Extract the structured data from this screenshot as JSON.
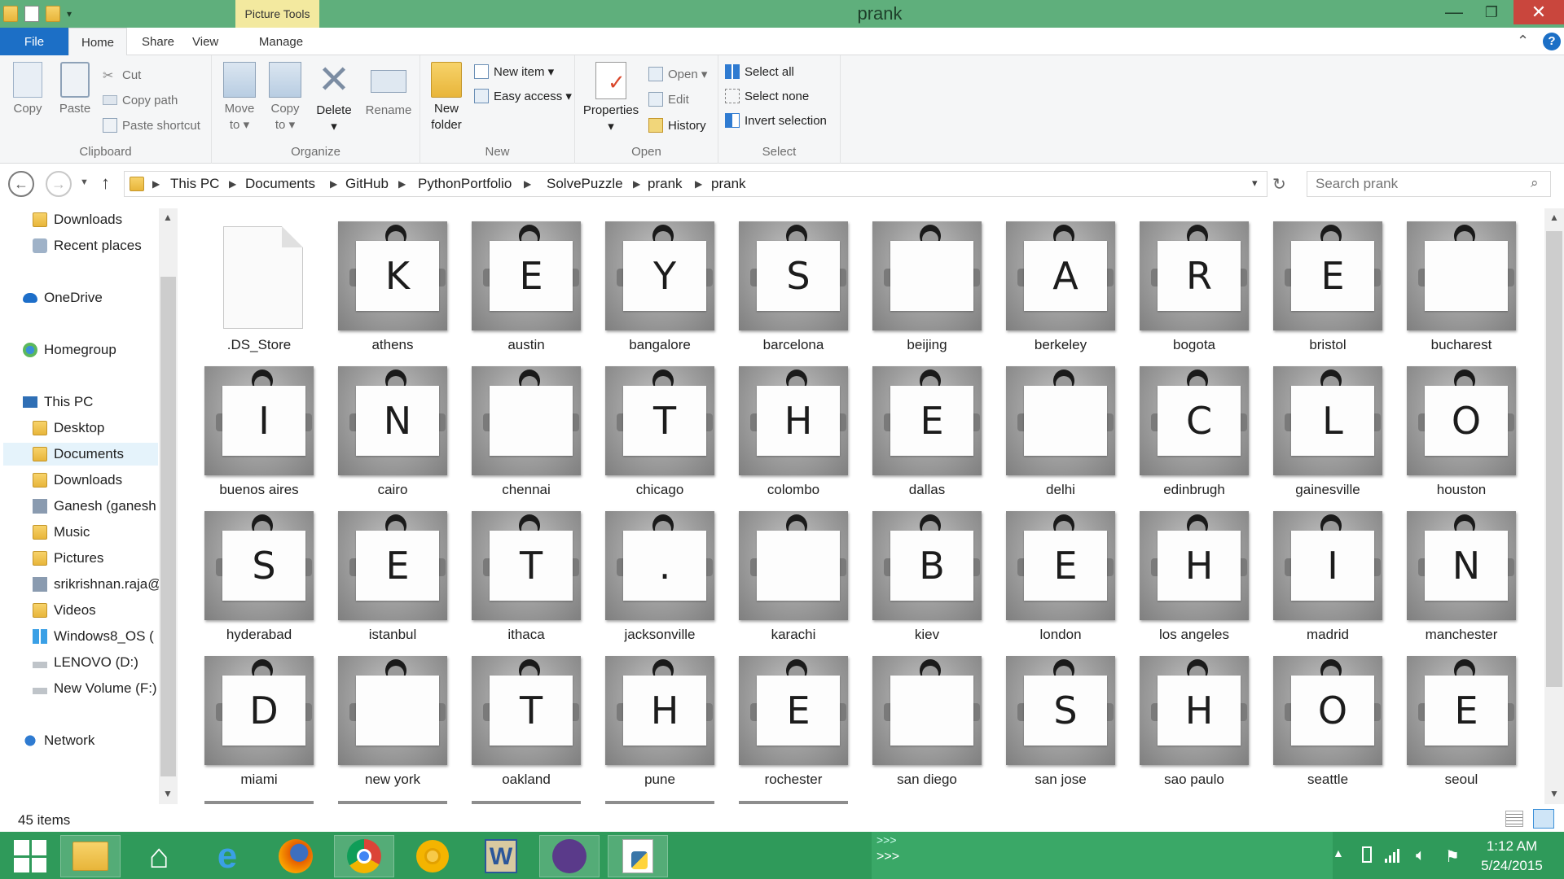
{
  "window": {
    "title": "prank",
    "context_tab": "Picture Tools",
    "minimize_glyph": "—",
    "restore_glyph": "❐",
    "close_glyph": "✕"
  },
  "ribbon_tabs": {
    "file": "File",
    "home": "Home",
    "share": "Share",
    "view": "View",
    "manage": "Manage"
  },
  "ribbon": {
    "clipboard": {
      "label": "Clipboard",
      "copy": "Copy",
      "paste": "Paste",
      "cut": "Cut",
      "copy_path": "Copy path",
      "paste_shortcut": "Paste shortcut"
    },
    "organize": {
      "label": "Organize",
      "move_to": "Move",
      "move_to_2": "to ▾",
      "copy_to": "Copy",
      "copy_to_2": "to ▾",
      "delete": "Delete",
      "delete_2": "▾",
      "rename": "Rename"
    },
    "new": {
      "label": "New",
      "new_folder": "New",
      "new_folder_2": "folder",
      "new_item": "New item ▾",
      "easy_access": "Easy access ▾"
    },
    "open": {
      "label": "Open",
      "properties": "Properties",
      "properties_2": "▾",
      "open": "Open ▾",
      "edit": "Edit",
      "history": "History"
    },
    "select": {
      "label": "Select",
      "select_all": "Select all",
      "select_none": "Select none",
      "invert_selection": "Invert selection"
    }
  },
  "address": {
    "breadcrumbs": [
      "This PC",
      "Documents",
      "GitHub",
      "PythonPortfolio",
      "SolvePuzzle",
      "prank",
      "prank"
    ],
    "search_placeholder": "Search prank"
  },
  "nav_pane": {
    "items": [
      {
        "label": "Downloads",
        "icon": "folder-icon"
      },
      {
        "label": "Recent places",
        "icon": "recent-places-icon"
      },
      {
        "label": "OneDrive",
        "icon": "cloud-icon"
      },
      {
        "label": "Homegroup",
        "icon": "homegroup-icon"
      },
      {
        "label": "This PC",
        "icon": "computer-icon"
      },
      {
        "label": "Desktop",
        "icon": "folder-icon"
      },
      {
        "label": "Documents",
        "icon": "folder-icon"
      },
      {
        "label": "Downloads",
        "icon": "folder-icon"
      },
      {
        "label": "Ganesh (ganesh",
        "icon": "folder-icon"
      },
      {
        "label": "Music",
        "icon": "folder-icon"
      },
      {
        "label": "Pictures",
        "icon": "folder-icon"
      },
      {
        "label": "srikrishnan.raja@",
        "icon": "folder-icon"
      },
      {
        "label": "Videos",
        "icon": "folder-icon"
      },
      {
        "label": "Windows8_OS (",
        "icon": "drive-icon"
      },
      {
        "label": "LENOVO (D:)",
        "icon": "drive-icon"
      },
      {
        "label": "New Volume (F:)",
        "icon": "drive-icon"
      },
      {
        "label": "Network",
        "icon": "network-icon"
      }
    ]
  },
  "files": [
    {
      "name": ".DS_Store",
      "letter": "",
      "type": "document"
    },
    {
      "name": "athens",
      "letter": "K",
      "type": "image"
    },
    {
      "name": "austin",
      "letter": "E",
      "type": "image"
    },
    {
      "name": "bangalore",
      "letter": "Y",
      "type": "image"
    },
    {
      "name": "barcelona",
      "letter": "S",
      "type": "image"
    },
    {
      "name": "beijing",
      "letter": "",
      "type": "image"
    },
    {
      "name": "berkeley",
      "letter": "A",
      "type": "image"
    },
    {
      "name": "bogota",
      "letter": "R",
      "type": "image"
    },
    {
      "name": "bristol",
      "letter": "E",
      "type": "image"
    },
    {
      "name": "bucharest",
      "letter": "",
      "type": "image"
    },
    {
      "name": "buenos aires",
      "letter": "I",
      "type": "image"
    },
    {
      "name": "cairo",
      "letter": "N",
      "type": "image"
    },
    {
      "name": "chennai",
      "letter": "",
      "type": "image"
    },
    {
      "name": "chicago",
      "letter": "T",
      "type": "image"
    },
    {
      "name": "colombo",
      "letter": "H",
      "type": "image"
    },
    {
      "name": "dallas",
      "letter": "E",
      "type": "image"
    },
    {
      "name": "delhi",
      "letter": "",
      "type": "image"
    },
    {
      "name": "edinbrugh",
      "letter": "C",
      "type": "image"
    },
    {
      "name": "gainesville",
      "letter": "L",
      "type": "image"
    },
    {
      "name": "houston",
      "letter": "O",
      "type": "image"
    },
    {
      "name": "hyderabad",
      "letter": "S",
      "type": "image"
    },
    {
      "name": "istanbul",
      "letter": "E",
      "type": "image"
    },
    {
      "name": "ithaca",
      "letter": "T",
      "type": "image"
    },
    {
      "name": "jacksonville",
      "letter": ".",
      "type": "image"
    },
    {
      "name": "karachi",
      "letter": "",
      "type": "image"
    },
    {
      "name": "kiev",
      "letter": "B",
      "type": "image"
    },
    {
      "name": "london",
      "letter": "E",
      "type": "image"
    },
    {
      "name": "los angeles",
      "letter": "H",
      "type": "image"
    },
    {
      "name": "madrid",
      "letter": "I",
      "type": "image"
    },
    {
      "name": "manchester",
      "letter": "N",
      "type": "image"
    },
    {
      "name": "miami",
      "letter": "D",
      "type": "image"
    },
    {
      "name": "new york",
      "letter": "",
      "type": "image"
    },
    {
      "name": "oakland",
      "letter": "T",
      "type": "image"
    },
    {
      "name": "pune",
      "letter": "H",
      "type": "image"
    },
    {
      "name": "rochester",
      "letter": "E",
      "type": "image"
    },
    {
      "name": "san diego",
      "letter": "",
      "type": "image"
    },
    {
      "name": "san jose",
      "letter": "S",
      "type": "image"
    },
    {
      "name": "sao paulo",
      "letter": "H",
      "type": "image"
    },
    {
      "name": "seattle",
      "letter": "O",
      "type": "image"
    },
    {
      "name": "seoul",
      "letter": "E",
      "type": "image"
    }
  ],
  "status": {
    "item_count": "45 items"
  },
  "taskbar": {
    "apps": [
      "windows-start-icon",
      "file-explorer-icon",
      "home-icon",
      "internet-explorer-icon",
      "firefox-icon",
      "chrome-icon",
      "chrome-canary-icon",
      "word-icon",
      "github-icon",
      "python-icon"
    ],
    "toolbar_chevrons_top": ">>>",
    "toolbar_chevrons_bottom": ">>>",
    "time": "1:12 AM",
    "date": "5/24/2015"
  },
  "colors": {
    "titlebar": "#5faf7c",
    "file_tab": "#1c6fc6",
    "picture_tools": "#f3e99f",
    "taskbar": "#2f9a5a",
    "close_button": "#c9463d"
  }
}
